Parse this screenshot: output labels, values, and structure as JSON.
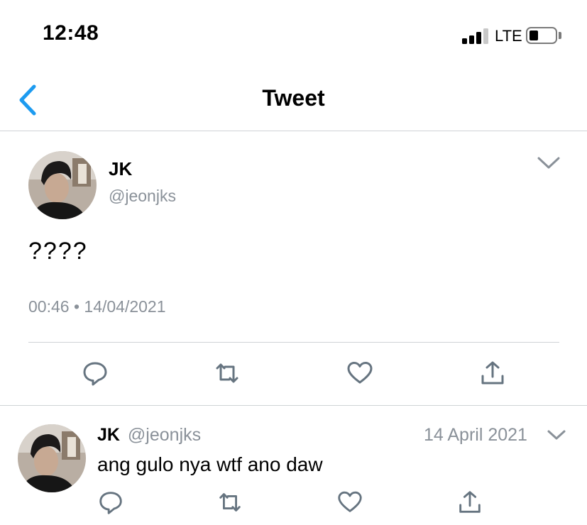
{
  "status_bar": {
    "time": "12:48",
    "network": "LTE",
    "icons": [
      "signal-icon",
      "battery-icon"
    ]
  },
  "nav": {
    "title": "Tweet",
    "back_icon": "chevron-left-icon"
  },
  "main_tweet": {
    "author_name": "JK",
    "author_handle": "@jeonjks",
    "text": "????",
    "time": "00:46",
    "separator": "•",
    "date": "14/04/2021",
    "icons": [
      "avatar",
      "chevron-down-icon"
    ]
  },
  "actions": [
    "reply-icon",
    "retweet-icon",
    "like-icon",
    "share-icon"
  ],
  "reply_tweet": {
    "author_name": "JK",
    "author_handle": "@jeonjks",
    "date": "14 April 2021",
    "text": "ang gulo nya wtf ano daw",
    "icons": [
      "avatar",
      "chevron-down-icon"
    ]
  },
  "colors": {
    "accent_blue": "#1d9bf0",
    "secondary_text": "#8a9199",
    "icon_gray": "#667480",
    "divider": "#cfd3d6"
  }
}
